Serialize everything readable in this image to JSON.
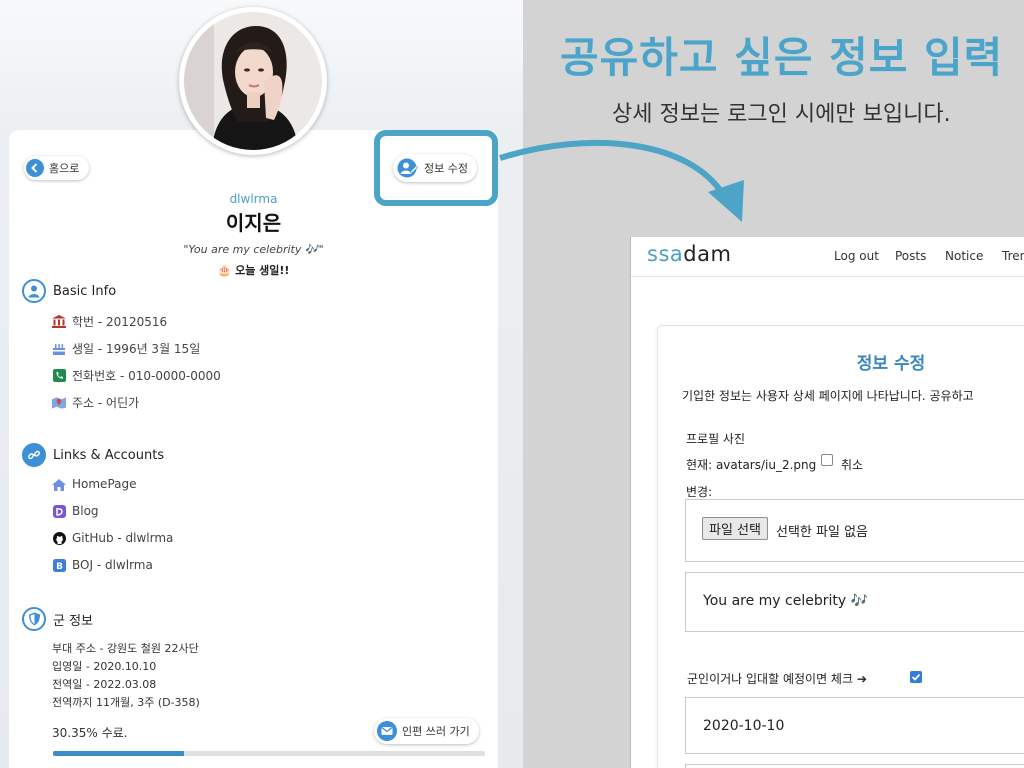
{
  "profile": {
    "home_label": "홈으로",
    "edit_label": "정보 수정",
    "username": "dlwlrma",
    "name": "이지은",
    "quote": "\"You are my celebrity 🎶\"",
    "birthday_today": "🎂 오늘 생일!!"
  },
  "basic_info": {
    "title": "Basic Info",
    "items": [
      {
        "icon": "bank-icon",
        "text": "학번 - 20120516"
      },
      {
        "icon": "cake-icon",
        "text": "생일 - 1996년 3월 15일"
      },
      {
        "icon": "phone-icon",
        "text": "전화번호 - 010-0000-0000"
      },
      {
        "icon": "map-icon",
        "text": "주소 - 어딘가"
      }
    ]
  },
  "links": {
    "title": "Links & Accounts",
    "items": [
      {
        "icon": "home-icon",
        "text": "HomePage"
      },
      {
        "icon": "blog-icon",
        "text": "Blog"
      },
      {
        "icon": "github-icon",
        "text": "GitHub - dlwlrma"
      },
      {
        "icon": "boj-icon",
        "text": "BOJ - dlwlrma"
      }
    ]
  },
  "military": {
    "title": "군 정보",
    "lines": [
      "부대 주소 - 강원도 철원 22사단",
      "입영일 - 2020.10.10",
      "전역일 - 2022.03.08",
      "전역까지 11개월, 3주 (D-358)"
    ],
    "progress_label": "30.35% 수료.",
    "progress_percent": 30.35,
    "letter_button": "인편 쓰러 가기"
  },
  "annotation": {
    "title": "공유하고 싶은 정보 입력",
    "subtitle": "상세 정보는 로그인 시에만 보입니다.",
    "accent_color": "#4ba4c9"
  },
  "app": {
    "brand_part1": "ssa",
    "brand_part2": "dam",
    "nav": [
      "Log out",
      "Posts",
      "Notice",
      "Tren"
    ]
  },
  "form": {
    "title": "정보 수정",
    "description": "기입한 정보는 사용자 상세 페이지에 나타납니다. 공유하고",
    "photo_label": "프로필 사진",
    "current_label": "현재: avatars/iu_2.png",
    "cancel_label": "취소",
    "change_label": "변경:",
    "file_button": "파일 선택",
    "file_none": "선택한 파일 없음",
    "quote_value": "You are my celebrity 🎶",
    "military_check_label": "군인이거나 입대할 예정이면 체크 ➔",
    "military_checked": true,
    "enlist_date_value": "2020-10-10"
  }
}
